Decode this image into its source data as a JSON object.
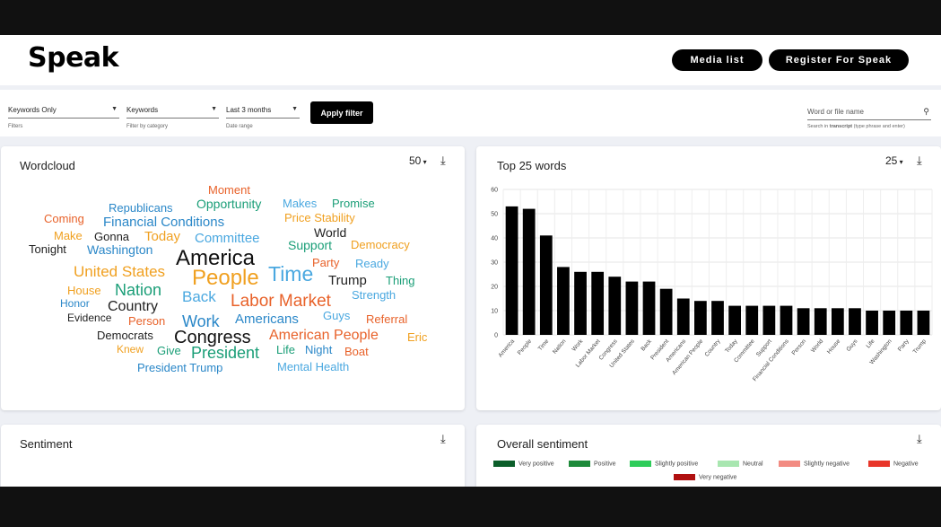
{
  "header": {
    "logo": "Speak",
    "media_list": "Media list",
    "register": "Register For Speak"
  },
  "filters": {
    "filter1": {
      "value": "Keywords Only",
      "hint": "Filters"
    },
    "filter2": {
      "value": "Keywords",
      "hint": "Filter by category"
    },
    "filter3": {
      "value": "Last 3 months",
      "hint": "Date range"
    },
    "apply": "Apply filter",
    "search_placeholder": "Word or file name",
    "search_hint_prefix": "Search in ",
    "search_hint_bold": "transcript",
    "search_hint_suffix": " (type phrase and enter)"
  },
  "wordcloud": {
    "title": "Wordcloud",
    "count": "50",
    "words": [
      {
        "text": "Moment",
        "color": "#e8622a"
      },
      {
        "text": "Republicans",
        "color": "#2a87c8"
      },
      {
        "text": "Opportunity",
        "color": "#1a9e77"
      },
      {
        "text": "Makes",
        "color": "#4aa8e0"
      },
      {
        "text": "Promise",
        "color": "#1a9e77"
      },
      {
        "text": "Coming",
        "color": "#e8622a"
      },
      {
        "text": "Financial Conditions",
        "color": "#2a87c8"
      },
      {
        "text": "Price Stability",
        "color": "#f0a020"
      },
      {
        "text": "Make",
        "color": "#f0a020"
      },
      {
        "text": "Gonna",
        "color": "#222222"
      },
      {
        "text": "Today",
        "color": "#f0a020"
      },
      {
        "text": "Committee",
        "color": "#4aa8e0"
      },
      {
        "text": "World",
        "color": "#222222"
      },
      {
        "text": "Tonight",
        "color": "#222222"
      },
      {
        "text": "Washington",
        "color": "#2a87c8"
      },
      {
        "text": "America",
        "color": "#111111"
      },
      {
        "text": "Support",
        "color": "#1a9e77"
      },
      {
        "text": "Democracy",
        "color": "#f0a020"
      },
      {
        "text": "Party",
        "color": "#e8622a"
      },
      {
        "text": "Ready",
        "color": "#4aa8e0"
      },
      {
        "text": "United States",
        "color": "#f0a020"
      },
      {
        "text": "People",
        "color": "#f0a020"
      },
      {
        "text": "Time",
        "color": "#4aa8e0"
      },
      {
        "text": "Trump",
        "color": "#222222"
      },
      {
        "text": "Thing",
        "color": "#1a9e77"
      },
      {
        "text": "House",
        "color": "#f0a020"
      },
      {
        "text": "Nation",
        "color": "#1a9e77"
      },
      {
        "text": "Back",
        "color": "#4aa8e0"
      },
      {
        "text": "Labor Market",
        "color": "#e8622a"
      },
      {
        "text": "Strength",
        "color": "#4aa8e0"
      },
      {
        "text": "Honor",
        "color": "#2a87c8"
      },
      {
        "text": "Country",
        "color": "#222222"
      },
      {
        "text": "Evidence",
        "color": "#222222"
      },
      {
        "text": "Person",
        "color": "#e8622a"
      },
      {
        "text": "Work",
        "color": "#2a87c8"
      },
      {
        "text": "Americans",
        "color": "#2a87c8"
      },
      {
        "text": "Guys",
        "color": "#4aa8e0"
      },
      {
        "text": "Referral",
        "color": "#e8622a"
      },
      {
        "text": "Democrats",
        "color": "#222222"
      },
      {
        "text": "Congress",
        "color": "#111111"
      },
      {
        "text": "American People",
        "color": "#e8622a"
      },
      {
        "text": "Eric",
        "color": "#f0a020"
      },
      {
        "text": "Knew",
        "color": "#f0a020"
      },
      {
        "text": "Give",
        "color": "#1a9e77"
      },
      {
        "text": "President",
        "color": "#1a9e77"
      },
      {
        "text": "Life",
        "color": "#1a9e77"
      },
      {
        "text": "Night",
        "color": "#2a87c8"
      },
      {
        "text": "Boat",
        "color": "#e8622a"
      },
      {
        "text": "President Trump",
        "color": "#2a87c8"
      },
      {
        "text": "Mental Health",
        "color": "#4aa8e0"
      }
    ]
  },
  "top_words": {
    "title": "Top 25 words",
    "count": "25"
  },
  "chart_data": {
    "type": "bar",
    "categories": [
      "America",
      "People",
      "Time",
      "Nation",
      "Work",
      "Labor Market",
      "Congress",
      "United States",
      "Back",
      "President",
      "Americans",
      "American People",
      "Country",
      "Today",
      "Committee",
      "Support",
      "Financial Conditions",
      "Person",
      "World",
      "House",
      "Guys",
      "Life",
      "Washington",
      "Party",
      "Trump"
    ],
    "values": [
      53,
      52,
      41,
      28,
      26,
      26,
      24,
      22,
      22,
      19,
      15,
      14,
      14,
      12,
      12,
      12,
      12,
      11,
      11,
      11,
      11,
      10,
      10,
      10,
      10
    ],
    "title": "",
    "xlabel": "",
    "ylabel": "",
    "ylim": [
      0,
      60
    ],
    "yticks": [
      0,
      10,
      20,
      30,
      40,
      50,
      60
    ],
    "grid": true,
    "bar_color": "#000000"
  },
  "sentiment": {
    "title": "Sentiment",
    "yticks": [
      "1.0",
      "0.8"
    ]
  },
  "overall": {
    "title": "Overall sentiment",
    "legend": [
      {
        "label": "Very positive",
        "color": "#0b5e2a"
      },
      {
        "label": "Positive",
        "color": "#1e8a3a"
      },
      {
        "label": "Slightly positive",
        "color": "#2ecc5a"
      },
      {
        "label": "Neutral",
        "color": "#a8e6b0"
      },
      {
        "label": "Slightly negative",
        "color": "#f28b82"
      },
      {
        "label": "Negative",
        "color": "#e8362a"
      },
      {
        "label": "Very negative",
        "color": "#b01010"
      }
    ]
  },
  "icons": {
    "download": "download-icon",
    "search": "search-icon",
    "dropdown": "chevron-down-icon"
  }
}
